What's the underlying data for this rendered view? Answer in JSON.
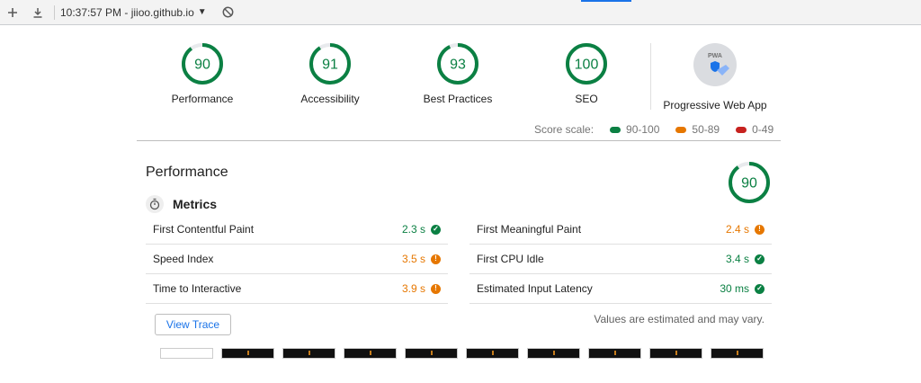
{
  "toolbar": {
    "report_label": "10:37:57 PM - jiioo.github.io",
    "new_icon": "plus-icon",
    "download_icon": "download-icon",
    "clear_icon": "block-icon"
  },
  "categories": [
    {
      "label": "Performance",
      "score": "90",
      "value": 90
    },
    {
      "label": "Accessibility",
      "score": "91",
      "value": 91
    },
    {
      "label": "Best Practices",
      "score": "93",
      "value": 93
    },
    {
      "label": "SEO",
      "score": "100",
      "value": 100
    }
  ],
  "pwa": {
    "label": "Progressive Web App",
    "badge": "PWA"
  },
  "score_scale": {
    "label": "Score scale:",
    "ranges": [
      {
        "label": "90-100",
        "color": "#0b8043"
      },
      {
        "label": "50-89",
        "color": "#e67700"
      },
      {
        "label": "0-49",
        "color": "#c7221f"
      }
    ]
  },
  "performance": {
    "title": "Performance",
    "score": "90",
    "value": 90,
    "metrics_title": "Metrics",
    "metrics": [
      {
        "name": "First Contentful Paint",
        "value": "2.3 s",
        "status": "pass"
      },
      {
        "name": "First Meaningful Paint",
        "value": "2.4 s",
        "status": "average"
      },
      {
        "name": "Speed Index",
        "value": "3.5 s",
        "status": "average"
      },
      {
        "name": "First CPU Idle",
        "value": "3.4 s",
        "status": "pass"
      },
      {
        "name": "Time to Interactive",
        "value": "3.9 s",
        "status": "average"
      },
      {
        "name": "Estimated Input Latency",
        "value": "30 ms",
        "status": "pass"
      }
    ],
    "view_trace": "View Trace",
    "estimate_note": "Values are estimated and may vary."
  },
  "colors": {
    "pass": "#0b8043",
    "average": "#e67700",
    "fail": "#c7221f"
  }
}
